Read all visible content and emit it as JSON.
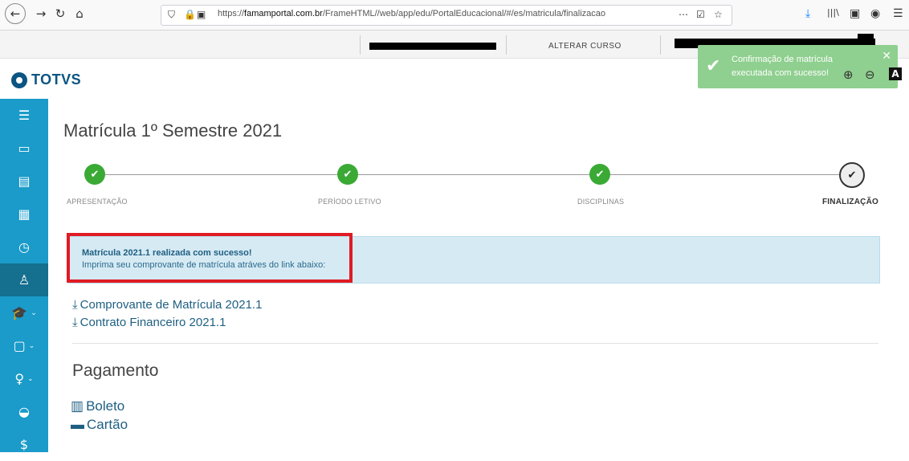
{
  "browser": {
    "url_prefix": "https://",
    "url_domain": "famamportal.com.br",
    "url_path": "/FrameHTML//web/app/edu/PortalEducacional/#/es/matricula/finalizacao",
    "more_icon": "⋯",
    "pocket_icon": "☑",
    "bookmark_icon": "☆",
    "download_icon": "⤓",
    "library_icon": "|||\\",
    "reader_icon": "▣",
    "menu_icon": "☰"
  },
  "appbar": {
    "alterar_curso": "ALTERAR CURSO"
  },
  "logo": {
    "text": "TOTVS"
  },
  "toast": {
    "message": "Confirmação de matrícula executada com sucesso!",
    "close": "✕"
  },
  "zoom": {
    "in": "⊕",
    "out": "⊖",
    "access": "A"
  },
  "sidebar": {
    "items": [
      {
        "icon": "☰"
      },
      {
        "icon": "▭"
      },
      {
        "icon": "▤"
      },
      {
        "icon": "▦"
      },
      {
        "icon": "◷"
      },
      {
        "icon": "♙"
      },
      {
        "icon": "🎓",
        "chev": "⌄"
      },
      {
        "icon": "▢",
        "chev": "⌄"
      },
      {
        "icon": "♀",
        "chev": "⌄"
      },
      {
        "icon": "◒"
      },
      {
        "icon": "$"
      }
    ]
  },
  "page": {
    "title": "Matrícula 1º Semestre 2021"
  },
  "steps": [
    {
      "label": "APRESENTAÇÃO",
      "done": true
    },
    {
      "label": "PERÍODO LETIVO",
      "done": true
    },
    {
      "label": "DISCIPLINAS",
      "done": true
    },
    {
      "label": "FINALIZAÇÃO",
      "done": false
    }
  ],
  "alert": {
    "strong": "Matrícula 2021.1 realizada com sucesso!",
    "text": "Imprima seu comprovante de matrícula atráves do link abaixo:"
  },
  "downloads": [
    {
      "label": "Comprovante de Matrícula 2021.1"
    },
    {
      "label": "Contrato Financeiro 2021.1"
    }
  ],
  "payment": {
    "title": "Pagamento",
    "boleto": "Boleto",
    "cartao": "Cartão"
  },
  "colors": {
    "sidebar": "#1a9bc9",
    "step_done": "#3aaa35",
    "link": "#1e5f82",
    "highlight": "#e01b24",
    "toast": "#8fcf8f"
  }
}
